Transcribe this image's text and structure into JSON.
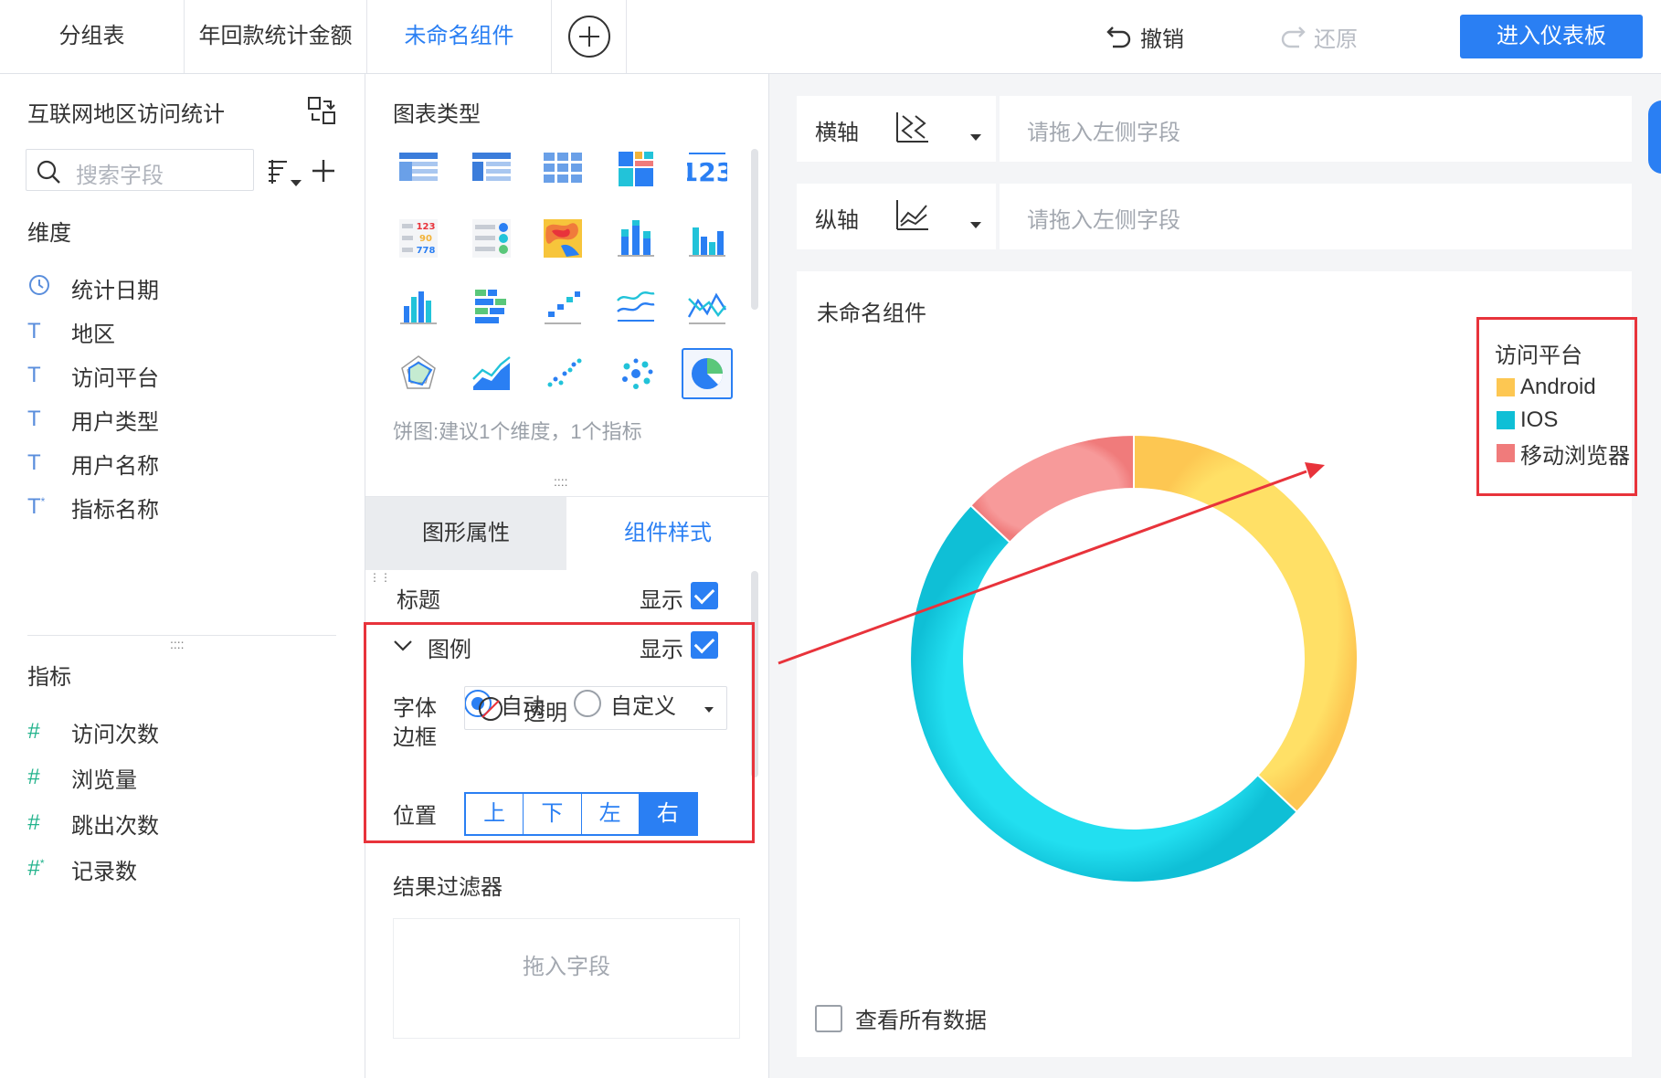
{
  "topbar": {
    "tabs": [
      {
        "label": "分组表"
      },
      {
        "label": "年回款统计金额"
      },
      {
        "label": "未命名组件"
      }
    ],
    "undo_label": "撤销",
    "redo_label": "还原",
    "enter_dashboard_label": "进入仪表板"
  },
  "left_panel": {
    "dataset_title": "互联网地区访问统计",
    "search_placeholder": "搜索字段",
    "dimension_label": "维度",
    "dimensions": [
      {
        "icon": "clock-icon",
        "label": "统计日期"
      },
      {
        "icon": "text-type-icon",
        "label": "地区"
      },
      {
        "icon": "text-type-icon",
        "label": "访问平台"
      },
      {
        "icon": "text-type-icon",
        "label": "用户类型"
      },
      {
        "icon": "text-type-icon",
        "label": "用户名称"
      },
      {
        "icon": "text-type-calc-icon",
        "label": "指标名称"
      }
    ],
    "measure_label": "指标",
    "measures": [
      {
        "icon": "number-type-icon",
        "label": "访问次数"
      },
      {
        "icon": "number-type-icon",
        "label": "浏览量"
      },
      {
        "icon": "number-type-icon",
        "label": "跳出次数"
      },
      {
        "icon": "number-type-calc-icon",
        "label": "记录数"
      }
    ]
  },
  "middle_panel": {
    "chart_type_label": "图表类型",
    "chart_type_hint": "饼图:建议1个维度，1个指标",
    "tabs": {
      "graph_props": "图形属性",
      "component_style": "组件样式"
    },
    "title_row": {
      "label": "标题",
      "show_label": "显示"
    },
    "legend_row": {
      "label": "图例",
      "show_label": "显示"
    },
    "font_row": {
      "label": "字体",
      "auto": "自动",
      "custom": "自定义"
    },
    "border_row": {
      "label": "边框",
      "value": "透明"
    },
    "position_row": {
      "label": "位置",
      "options": [
        "上",
        "下",
        "左",
        "右"
      ],
      "selected": "右"
    },
    "result_filter_label": "结果过滤器",
    "drop_field_placeholder": "拖入字段"
  },
  "canvas": {
    "x_axis_label": "横轴",
    "y_axis_label": "纵轴",
    "x_axis_placeholder": "请拖入左侧字段",
    "y_axis_placeholder": "请拖入左侧字段",
    "widget_title": "未命名组件",
    "view_all_data_label": "查看所有数据"
  },
  "chart_data": {
    "type": "pie",
    "variant": "donut",
    "legend_title": "访问平台",
    "legend_position": "top-right",
    "categories": [
      "Android",
      "IOS",
      "移动浏览器"
    ],
    "values": [
      37,
      50,
      13
    ],
    "colors": [
      "#fdc752",
      "#0fbfd6",
      "#f07b7b"
    ]
  },
  "colors": {
    "accent": "#2a7ff3",
    "annotation_red": "#e8333b"
  }
}
